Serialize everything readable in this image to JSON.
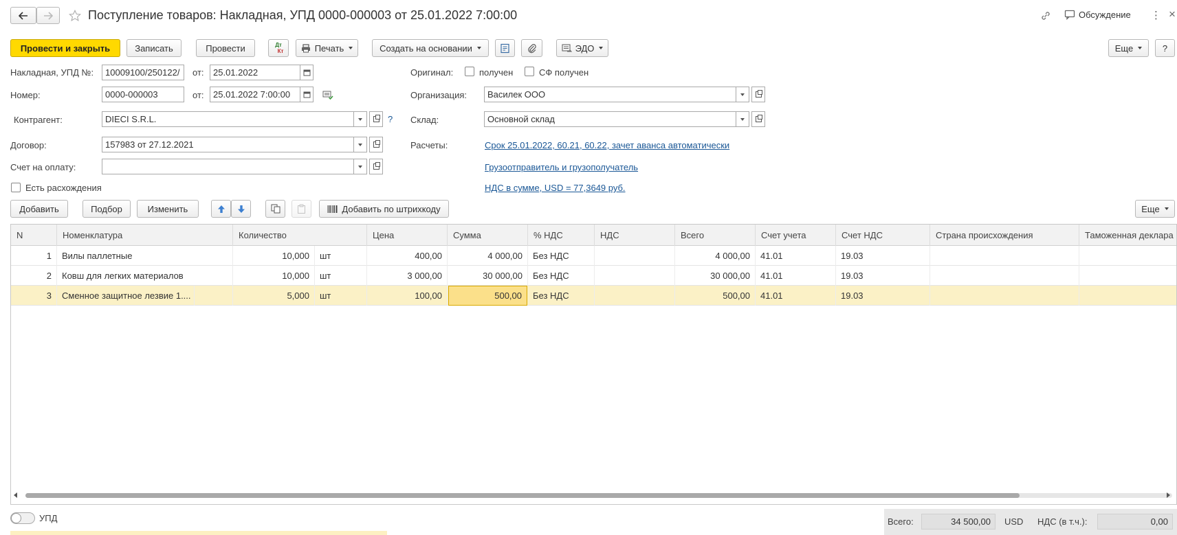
{
  "header": {
    "title": "Поступление товаров: Накладная, УПД 0000-000003 от 25.01.2022 7:00:00",
    "discussion": "Обсуждение"
  },
  "toolbar": {
    "post_close": "Провести и закрыть",
    "save": "Записать",
    "post": "Провести",
    "dtkt_top": "Дт",
    "dtkt_bottom": "Кт",
    "print": "Печать",
    "create_based": "Создать на основании",
    "edo": "ЭДО",
    "more": "Еще",
    "help": "?"
  },
  "form": {
    "invoice_label": "Накладная, УПД №:",
    "invoice_value": "10009100/250122/",
    "from_label": "от:",
    "invoice_date": "25.01.2022",
    "number_label": "Номер:",
    "number_value": "0000-000003",
    "number_date": "25.01.2022  7:00:00",
    "counterparty_label": "Контрагент:",
    "counterparty_value": "DIECI S.R.L.",
    "counterparty_help": "?",
    "contract_label": "Договор:",
    "contract_value": "157983 от 27.12.2021",
    "payment_invoice_label": "Счет на оплату:",
    "payment_invoice_value": "",
    "discrepancy_label": "Есть расхождения",
    "original_label": "Оригинал:",
    "received_label": "получен",
    "sf_received_label": "СФ получен",
    "organization_label": "Организация:",
    "organization_value": "Василек ООО",
    "warehouse_label": "Склад:",
    "warehouse_value": "Основной склад",
    "settlements_label": "Расчеты:",
    "settlements_link": "Срок 25.01.2022, 60.21, 60.22, зачет аванса автоматически",
    "shipper_link": "Грузоотправитель и грузополучатель",
    "vat_link": "НДС в сумме, USD = 77,3649 руб."
  },
  "table_toolbar": {
    "add": "Добавить",
    "select": "Подбор",
    "change": "Изменить",
    "barcode": "Добавить по штрихкоду",
    "more": "Еще"
  },
  "table": {
    "columns": [
      "N",
      "Номенклатура",
      "Количество",
      "Цена",
      "Сумма",
      "% НДС",
      "НДС",
      "Всего",
      "Счет учета",
      "Счет НДС",
      "Страна происхождения",
      "Таможенная деклара"
    ],
    "rows": [
      {
        "n": "1",
        "name": "Вилы паллетные",
        "qty": "10,000",
        "unit": "шт",
        "price": "400,00",
        "sum": "4 000,00",
        "vat_rate": "Без НДС",
        "vat": "",
        "total": "4 000,00",
        "account": "41.01",
        "vat_account": "19.03",
        "country": "",
        "customs": ""
      },
      {
        "n": "2",
        "name": "Ковш для легких материалов",
        "qty": "10,000",
        "unit": "шт",
        "price": "3 000,00",
        "sum": "30 000,00",
        "vat_rate": "Без НДС",
        "vat": "",
        "total": "30 000,00",
        "account": "41.01",
        "vat_account": "19.03",
        "country": "",
        "customs": ""
      },
      {
        "n": "3",
        "name": "Сменное защитное лезвие 1....",
        "qty": "5,000",
        "unit": "шт",
        "price": "100,00",
        "sum": "500,00",
        "vat_rate": "Без НДС",
        "vat": "",
        "total": "500,00",
        "account": "41.01",
        "vat_account": "19.03",
        "country": "",
        "customs": ""
      }
    ]
  },
  "footer": {
    "upd_label": "УПД",
    "total_label": "Всего:",
    "total_value": "34 500,00",
    "currency": "USD",
    "vat_label": "НДС (в т.ч.):",
    "vat_value": "0,00"
  },
  "colors": {
    "accent_yellow": "#ffd900",
    "selected_row": "#fbf1c6",
    "link": "#1a5796"
  }
}
